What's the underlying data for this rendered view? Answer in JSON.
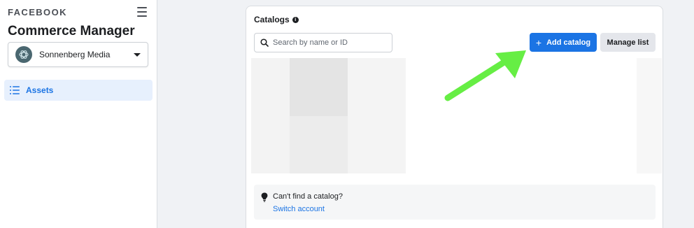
{
  "sidebar": {
    "brand": "FACEBOOK",
    "app_title": "Commerce Manager",
    "account": {
      "name": "Sonnenberg Media"
    },
    "nav": [
      {
        "label": "Assets",
        "icon": "list-icon",
        "active": true
      }
    ]
  },
  "catalogs": {
    "title": "Catalogs",
    "search": {
      "placeholder": "Search by name or ID",
      "value": ""
    },
    "add_button": "Add catalog",
    "manage_button": "Manage list",
    "tip": {
      "text": "Can't find a catalog?",
      "link": "Switch account"
    }
  },
  "colors": {
    "accent": "#1b74e4",
    "arrow": "#66ee44",
    "active_nav_bg": "#e7f0fd"
  }
}
